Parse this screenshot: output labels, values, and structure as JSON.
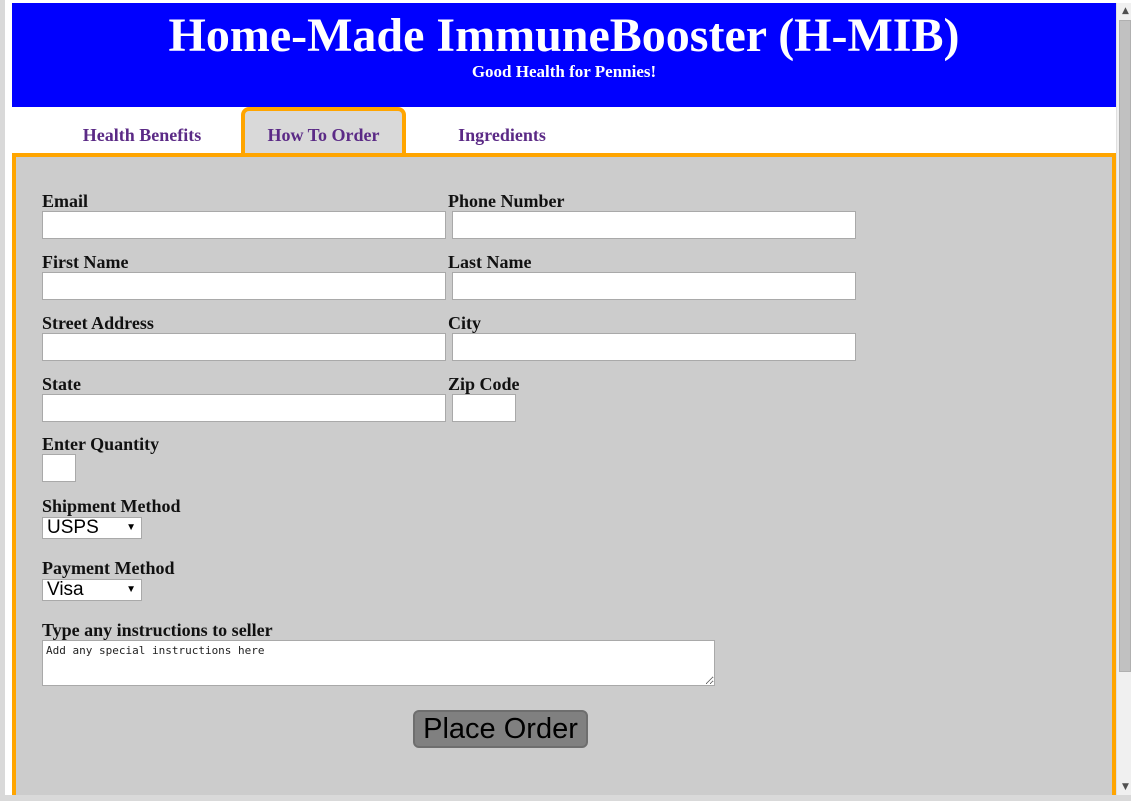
{
  "header": {
    "title": "Home-Made ImmuneBooster (H-MIB)",
    "tagline": "Good Health for Pennies!",
    "background_color": "#0000ff"
  },
  "tabs": [
    {
      "label": "Health Benefits",
      "active": false
    },
    {
      "label": "How To Order",
      "active": true
    },
    {
      "label": "Ingredients",
      "active": false
    }
  ],
  "form": {
    "email_label": "Email",
    "phone_label": "Phone Number",
    "first_name_label": "First Name",
    "last_name_label": "Last Name",
    "street_label": "Street Address",
    "city_label": "City",
    "state_label": "State",
    "zip_label": "Zip Code",
    "quantity_label": "Enter Quantity",
    "shipment_label": "Shipment Method",
    "shipment_value": "USPS",
    "payment_label": "Payment Method",
    "payment_value": "Visa",
    "instructions_label": "Type any instructions to seller",
    "instructions_placeholder": "Add any special instructions here",
    "submit_label": "Place Order"
  },
  "colors": {
    "accent_border": "#ffa500",
    "tab_text": "#5b2a86",
    "panel_background": "#cccccc"
  },
  "icons": {
    "dropdown": "chevron-down-icon",
    "scroll_up": "arrow-up-icon",
    "scroll_down": "arrow-down-icon"
  }
}
